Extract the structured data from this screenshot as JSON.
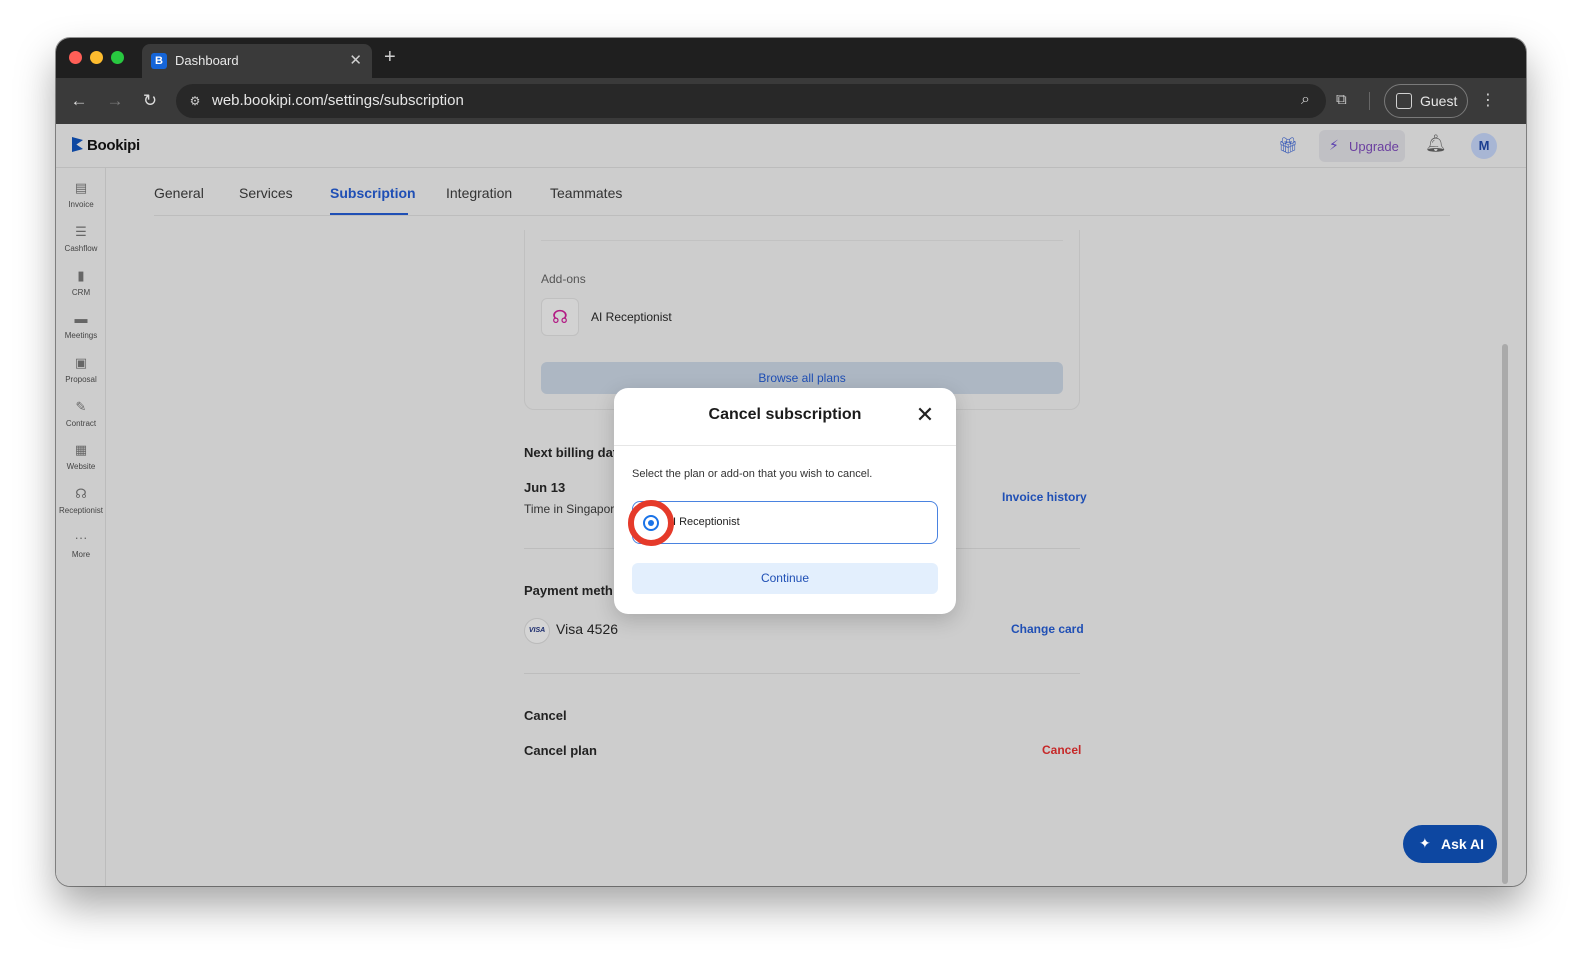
{
  "browser": {
    "tab_title": "Dashboard",
    "favicon_letter": "B",
    "url": "web.bookipi.com/settings/subscription",
    "profile_label": "Guest"
  },
  "app": {
    "brand": "Bookipi",
    "upgrade_label": "Upgrade",
    "avatar_initial": "M",
    "ask_ai_label": "Ask AI"
  },
  "sidebar": {
    "items": [
      {
        "label": "Invoice",
        "icon": "invoice-icon"
      },
      {
        "label": "Cashflow",
        "icon": "cashflow-icon"
      },
      {
        "label": "CRM",
        "icon": "crm-icon"
      },
      {
        "label": "Meetings",
        "icon": "meetings-icon"
      },
      {
        "label": "Proposal",
        "icon": "proposal-icon"
      },
      {
        "label": "Contract",
        "icon": "contract-icon"
      },
      {
        "label": "Website",
        "icon": "website-icon"
      },
      {
        "label": "Receptionist",
        "icon": "headset-icon"
      },
      {
        "label": "More",
        "icon": "more-icon"
      }
    ]
  },
  "settings_tabs": [
    {
      "label": "General"
    },
    {
      "label": "Services"
    },
    {
      "label": "Subscription",
      "active": true
    },
    {
      "label": "Integration"
    },
    {
      "label": "Teammates"
    }
  ],
  "subscription": {
    "addons_label": "Add-ons",
    "addon_name": "AI Receptionist",
    "browse_label": "Browse all plans",
    "billing_title": "Next billing dat",
    "billing_date": "Jun 13",
    "billing_tz": "Time in Singapor",
    "invoice_history": "Invoice history",
    "payment_title": "Payment meth",
    "card_brand": "VISA",
    "card_label": "Visa 4526",
    "change_card": "Change card",
    "cancel_title": "Cancel",
    "cancel_plan_label": "Cancel plan",
    "cancel_link": "Cancel"
  },
  "modal": {
    "title": "Cancel subscription",
    "description": "Select the plan or add-on that you wish to cancel.",
    "option_label": "I Receptionist",
    "option_selected": true,
    "continue_label": "Continue"
  },
  "colors": {
    "accent": "#1f4fb5",
    "danger": "#c62828",
    "highlight_ring": "#e53a2a"
  }
}
